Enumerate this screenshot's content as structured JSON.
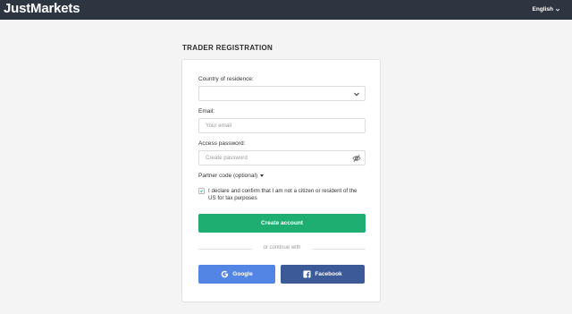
{
  "header": {
    "logo": "JustMarkets",
    "language": "English"
  },
  "page": {
    "title": "TRADER REGISTRATION"
  },
  "form": {
    "country_label": "Country of residence:",
    "country_value": "",
    "email_label": "Email:",
    "email_placeholder": "Your email",
    "password_label": "Access password:",
    "password_placeholder": "Create password",
    "partner_label": "Partner code (optional)",
    "declaration": "I declare and confirm that I am not a citizen or resident of the US for tax purposes",
    "declaration_checked": true,
    "create_button": "Create account",
    "divider_text": "or continue with",
    "google_button": "Google",
    "facebook_button": "Facebook"
  },
  "colors": {
    "topbar": "#2d3640",
    "primary": "#1fae72",
    "google": "#5386e4",
    "facebook": "#3d5a98"
  },
  "icons": {
    "language": "chevron-down-icon",
    "country": "chevron-down-icon",
    "password": "eye-off-icon",
    "partner": "caret-down-icon",
    "checkbox": "checkmark-icon",
    "google": "google-icon",
    "facebook": "facebook-icon"
  }
}
